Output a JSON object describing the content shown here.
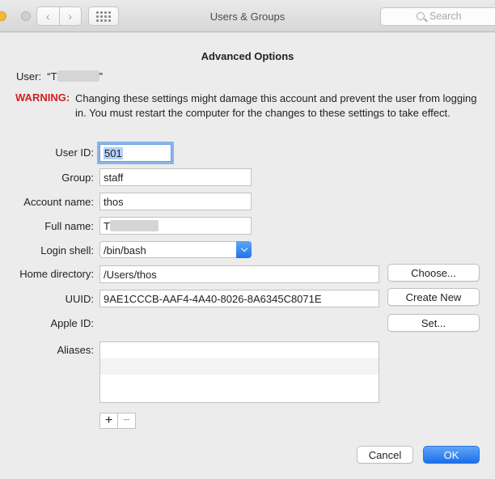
{
  "window": {
    "title": "Users & Groups",
    "search_placeholder": "Search"
  },
  "sheet": {
    "title": "Advanced Options",
    "user_label": "User:",
    "user_value_prefix": "“T",
    "user_value_suffix": "”",
    "warning_label": "WARNING:",
    "warning_text": "Changing these settings might damage this account and prevent the user from logging in. You must restart the computer for the changes to these settings to take effect."
  },
  "fields": {
    "user_id": {
      "label": "User ID:",
      "value": "501"
    },
    "group": {
      "label": "Group:",
      "value": "staff"
    },
    "account_name": {
      "label": "Account name:",
      "value": "thos"
    },
    "full_name": {
      "label": "Full name:",
      "value": "T"
    },
    "login_shell": {
      "label": "Login shell:",
      "value": "/bin/bash"
    },
    "home_directory": {
      "label": "Home directory:",
      "value": "/Users/thos"
    },
    "uuid": {
      "label": "UUID:",
      "value": "9AE1CCCB-AAF4-4A40-8026-8A6345C8071E"
    },
    "apple_id": {
      "label": "Apple ID:"
    },
    "aliases": {
      "label": "Aliases:"
    }
  },
  "buttons": {
    "choose": "Choose...",
    "create_new": "Create New",
    "set": "Set...",
    "add": "+",
    "remove": "−",
    "cancel": "Cancel",
    "ok": "OK"
  },
  "icons": {
    "back": "chevron-left-icon",
    "forward": "chevron-right-icon",
    "grid": "grid-icon",
    "search": "search-icon"
  }
}
